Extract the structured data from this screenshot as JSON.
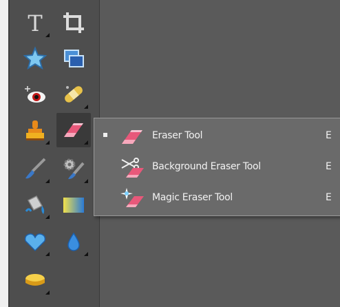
{
  "toolbox": {
    "tools": [
      {
        "icon": "type-tool-icon",
        "has_submenu": true
      },
      {
        "icon": "crop-tool-icon",
        "has_submenu": false
      },
      {
        "icon": "shape-star-icon",
        "has_submenu": false
      },
      {
        "icon": "recompose-tool-icon",
        "has_submenu": false
      },
      {
        "icon": "red-eye-tool-icon",
        "has_submenu": false
      },
      {
        "icon": "healing-brush-icon",
        "has_submenu": true
      },
      {
        "icon": "clone-stamp-icon",
        "has_submenu": true
      },
      {
        "icon": "eraser-tool-icon",
        "has_submenu": true,
        "active": true
      },
      {
        "icon": "brush-tool-icon",
        "has_submenu": true
      },
      {
        "icon": "smart-brush-icon",
        "has_submenu": true
      },
      {
        "icon": "paint-bucket-icon",
        "has_submenu": true
      },
      {
        "icon": "gradient-tool-icon",
        "has_submenu": false
      },
      {
        "icon": "custom-shape-heart-icon",
        "has_submenu": true
      },
      {
        "icon": "blur-drop-icon",
        "has_submenu": true
      },
      {
        "icon": "sponge-tool-icon",
        "has_submenu": true
      }
    ]
  },
  "flyout_menu": {
    "items": [
      {
        "label": "Eraser Tool",
        "shortcut": "E",
        "icon": "eraser-icon",
        "checked": true
      },
      {
        "label": "Background Eraser Tool",
        "shortcut": "E",
        "icon": "background-eraser-icon",
        "checked": false
      },
      {
        "label": "Magic Eraser Tool",
        "shortcut": "E",
        "icon": "magic-eraser-icon",
        "checked": false
      }
    ]
  },
  "colors": {
    "canvas_bg": "#5a5a5a",
    "toolbar_bg": "#4e4e4e",
    "menu_bg": "#6a6a6a",
    "eraser_pink": "#e8587a"
  }
}
